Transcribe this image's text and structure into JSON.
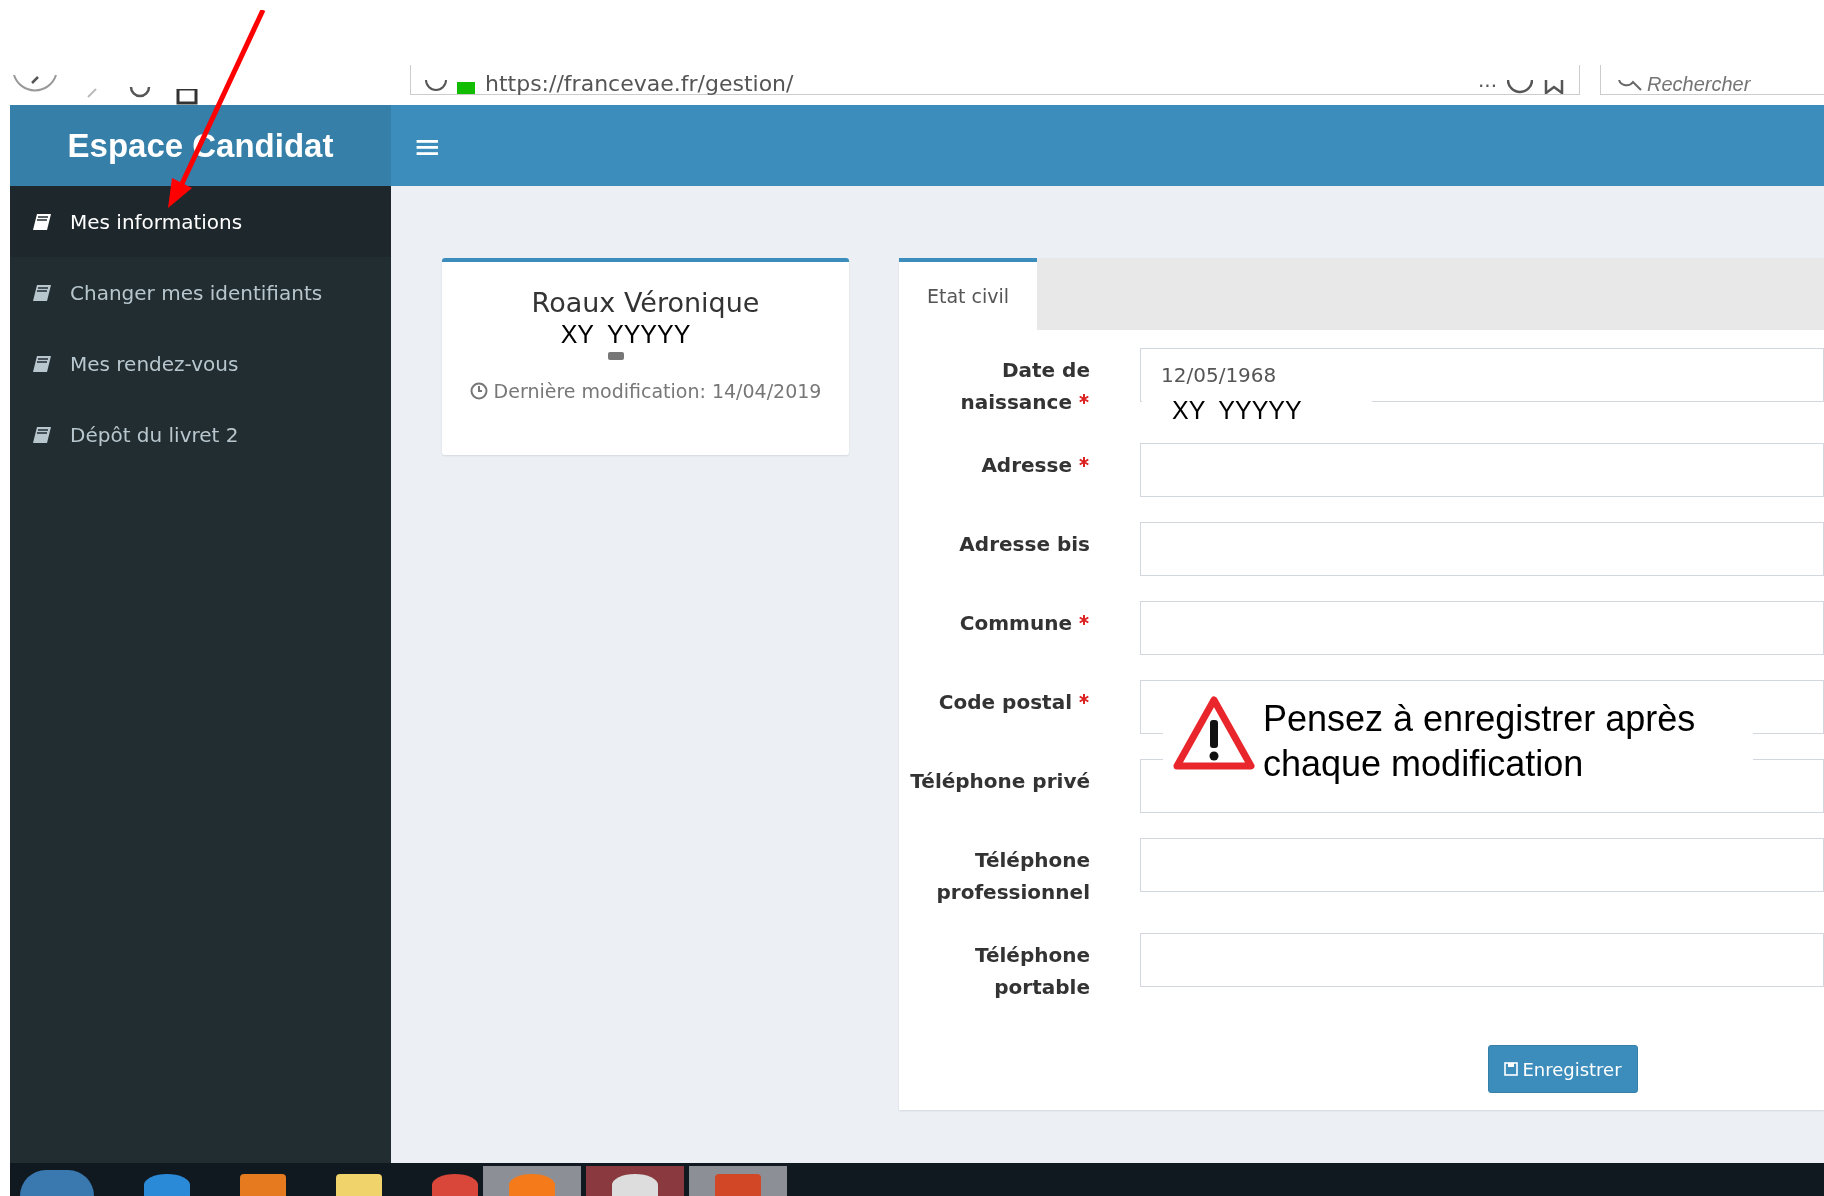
{
  "browser": {
    "url": "https://francevae.fr/gestion/",
    "more": "···",
    "search_placeholder": "Rechercher"
  },
  "header": {
    "title": "Espace Candidat",
    "menu_icon": "≡"
  },
  "sidebar": {
    "items": [
      {
        "label": "Mes informations",
        "selected": true
      },
      {
        "label": "Changer mes identifiants",
        "selected": false
      },
      {
        "label": "Mes rendez-vous",
        "selected": false
      },
      {
        "label": "Dépôt du livret 2",
        "selected": false
      }
    ]
  },
  "profile": {
    "name": "Roaux Véronique",
    "redaction": "XY  YYYYY",
    "last_modified": "Dernière modification: 14/04/2019"
  },
  "form": {
    "tabs": [
      {
        "label": "Etat civil",
        "selected": true
      }
    ],
    "fields": [
      {
        "label": "Date de naissance",
        "required": true,
        "value": "12/05/1968",
        "redaction": "XY  YYYYY"
      },
      {
        "label": "Adresse",
        "required": true
      },
      {
        "label": "Adresse bis",
        "required": false
      },
      {
        "label": "Commune",
        "required": true
      },
      {
        "label": "Code postal",
        "required": true
      },
      {
        "label": "Téléphone privé",
        "required": false
      },
      {
        "label": "Téléphone professionnel",
        "required": false
      },
      {
        "label": "Téléphone portable",
        "required": false
      }
    ],
    "save_button": "Enregistrer"
  },
  "callout": {
    "text": "Pensez à enregistrer après chaque modification"
  }
}
